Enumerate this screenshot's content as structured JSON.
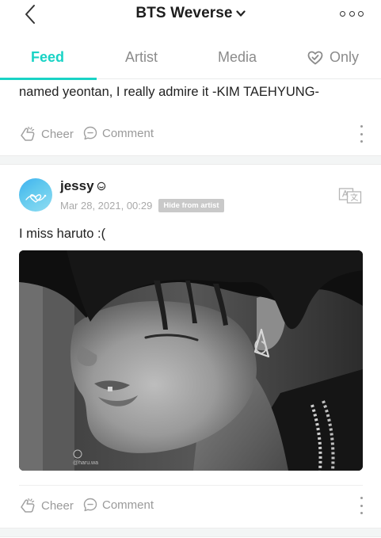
{
  "header": {
    "title": "BTS Weverse",
    "back_icon": "chevron-left-icon",
    "dropdown_icon": "chevron-down-icon",
    "more_icon": "more-horizontal-icon"
  },
  "tabs": [
    {
      "label": "Feed",
      "active": true
    },
    {
      "label": "Artist",
      "active": false
    },
    {
      "label": "Media",
      "active": false
    },
    {
      "label": "Only",
      "active": false,
      "icon": "heart-check-icon"
    }
  ],
  "colors": {
    "accent": "#19d3c5",
    "muted": "#9a9a9a",
    "badge_bg": "#c9c9c9"
  },
  "posts": [
    {
      "text": "named yeontan, I really admire it -KIM TAEHYUNG-",
      "actions": {
        "cheer": "Cheer",
        "comment": "Comment"
      }
    },
    {
      "username": "jessy",
      "username_badge": "smiley-icon",
      "date": "Mar 28, 2021, 00:29",
      "badge": "Hide from artist",
      "text": "I miss haruto :(",
      "image_alt": "black-and-white photo of a person with an earring",
      "watermark": "@haru.wa",
      "actions": {
        "cheer": "Cheer",
        "comment": "Comment"
      }
    }
  ]
}
